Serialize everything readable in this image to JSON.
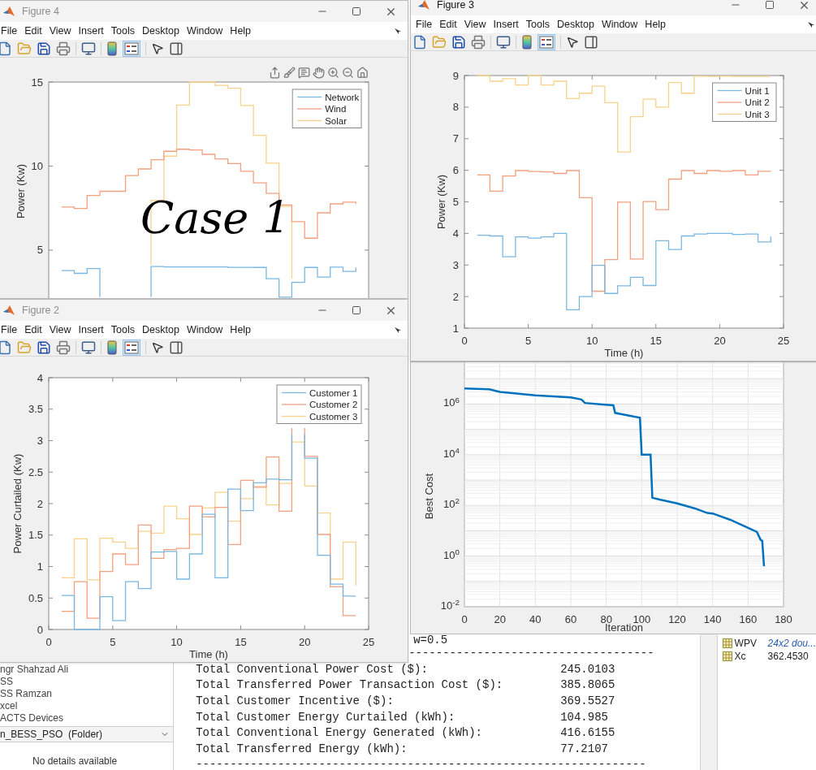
{
  "figures": [
    {
      "title": "Figure 4",
      "active": false,
      "menu": [
        "File",
        "Edit",
        "View",
        "Insert",
        "Tools",
        "Desktop",
        "Window",
        "Help"
      ],
      "legend_on": true,
      "axes_toolbar": true,
      "note": "Case 1",
      "chart_data": {
        "type": "line",
        "ylabel": "Power (Kw)",
        "x": [
          1,
          2,
          2,
          3,
          3,
          4,
          4,
          5,
          5,
          6,
          6,
          7,
          7,
          8,
          8,
          9,
          9,
          10,
          10,
          11,
          11,
          12,
          12,
          13,
          13,
          14,
          14,
          15,
          15,
          16,
          16,
          17,
          17,
          18,
          18,
          19,
          19,
          20,
          20,
          21,
          21,
          22,
          22,
          23,
          23,
          24,
          24
        ],
        "xlim": [
          0,
          25
        ],
        "ylim": [
          2,
          15
        ],
        "yticks": [
          5,
          10,
          15
        ],
        "legend": true,
        "series": [
          {
            "name": "Network",
            "color": "#7ab8e3",
            "values": [
              3.78,
              3.78,
              3.62,
              3.62,
              3.9,
              3.9,
              2.2,
              null,
              null,
              null,
              null,
              null,
              null,
              2.2,
              4.02,
              4.02,
              4.0,
              4.0,
              4.0,
              4.0,
              4.0,
              4.0,
              4.0,
              4.0,
              4.0,
              4.0,
              3.98,
              3.98,
              3.98,
              3.98,
              3.97,
              3.97,
              3.3,
              3.3,
              2.2,
              2.2,
              3.08,
              3.08,
              3.97,
              3.97,
              3.4,
              3.4,
              3.99,
              3.99,
              3.73,
              3.73,
              3.97
            ]
          },
          {
            "name": "Wind",
            "color": "#f2a07f",
            "values": [
              7.56,
              7.56,
              7.48,
              7.48,
              8.25,
              8.25,
              8.5,
              8.5,
              8.5,
              8.5,
              9.44,
              9.44,
              9.83,
              9.83,
              10.38,
              10.38,
              10.88,
              10.88,
              11.0,
              11.0,
              10.96,
              10.96,
              10.7,
              10.7,
              10.43,
              10.43,
              10.15,
              10.15,
              9.69,
              9.69,
              9.0,
              9.0,
              8.37,
              8.37,
              7.68,
              7.68,
              6.69,
              6.69,
              5.71,
              5.71,
              7.22,
              7.22,
              7.75,
              7.75,
              7.85,
              7.85,
              7.75
            ]
          },
          {
            "name": "Solar",
            "color": "#f8d28a",
            "values": [
              null,
              null,
              null,
              null,
              null,
              null,
              null,
              null,
              null,
              null,
              null,
              null,
              null,
              4.1,
              7.96,
              7.96,
              10.59,
              10.59,
              13.63,
              13.63,
              15.0,
              15.0,
              15.0,
              15.0,
              14.8,
              14.8,
              14.63,
              14.63,
              13.6,
              13.6,
              11.83,
              11.83,
              10.17,
              10.17,
              7.6,
              7.6,
              3.3,
              null,
              null,
              null,
              null,
              null,
              null,
              null,
              null,
              null,
              null
            ]
          }
        ]
      }
    },
    {
      "title": "Figure 3",
      "active": true,
      "menu": [
        "File",
        "Edit",
        "View",
        "Insert",
        "Tools",
        "Desktop",
        "Window",
        "Help"
      ],
      "legend_on": true,
      "axes_toolbar": false,
      "chart_data": {
        "type": "line",
        "xlabel": "Time (h)",
        "ylabel": "Power (Kw)",
        "x": [
          1,
          2,
          2,
          3,
          3,
          4,
          4,
          5,
          5,
          6,
          6,
          7,
          7,
          8,
          8,
          9,
          9,
          10,
          10,
          11,
          11,
          12,
          12,
          13,
          13,
          14,
          14,
          15,
          15,
          16,
          16,
          17,
          17,
          18,
          18,
          19,
          19,
          20,
          20,
          21,
          21,
          22,
          22,
          23,
          23,
          24,
          24
        ],
        "xlim": [
          0,
          25
        ],
        "ylim": [
          1,
          9
        ],
        "xticks": [
          0,
          5,
          10,
          15,
          20,
          25
        ],
        "yticks": [
          1,
          2,
          3,
          4,
          5,
          6,
          7,
          8,
          9
        ],
        "legend": true,
        "series": [
          {
            "name": "Unit 1",
            "color": "#7ab8e3",
            "values": [
              3.94,
              3.94,
              3.92,
              3.92,
              3.26,
              3.26,
              3.89,
              3.89,
              3.85,
              3.85,
              3.89,
              3.89,
              4.0,
              4.0,
              1.58,
              1.58,
              2.0,
              2.0,
              2.99,
              2.99,
              2.1,
              2.1,
              2.34,
              2.34,
              2.61,
              2.61,
              2.35,
              2.35,
              3.77,
              3.77,
              3.49,
              3.49,
              3.92,
              3.92,
              3.98,
              3.98,
              4.0,
              4.0,
              4.0,
              4.0,
              3.97,
              3.97,
              3.98,
              3.98,
              3.73,
              3.73,
              3.9
            ]
          },
          {
            "name": "Unit 2",
            "color": "#f2a07f",
            "values": [
              5.85,
              5.85,
              5.34,
              5.34,
              5.82,
              5.82,
              5.99,
              5.99,
              5.96,
              5.96,
              5.95,
              5.95,
              5.9,
              5.9,
              5.99,
              5.99,
              5.13,
              5.13,
              2.17,
              2.17,
              3.17,
              3.17,
              4.99,
              4.99,
              3.19,
              3.19,
              5.01,
              5.01,
              4.75,
              4.75,
              5.72,
              5.72,
              5.99,
              5.99,
              5.9,
              5.9,
              5.99,
              5.99,
              5.97,
              5.97,
              5.99,
              5.99,
              5.85,
              5.85,
              5.97,
              5.97,
              5.96
            ]
          },
          {
            "name": "Unit 3",
            "color": "#f8d28a",
            "values": [
              9.0,
              9.0,
              8.82,
              8.82,
              8.9,
              8.9,
              8.7,
              8.7,
              9.0,
              9.0,
              8.7,
              8.7,
              8.82,
              8.82,
              8.27,
              8.27,
              8.44,
              8.44,
              8.66,
              8.66,
              8.14,
              8.14,
              6.58,
              6.58,
              7.7,
              7.7,
              8.25,
              8.25,
              8.0,
              8.0,
              8.78,
              8.78,
              8.44,
              8.44,
              8.98,
              8.98,
              8.97,
              8.97,
              8.98,
              8.98,
              8.97,
              8.97,
              8.97,
              8.97,
              8.97,
              8.97,
              8.97
            ]
          }
        ]
      }
    }
  ],
  "convergence_plot": {
    "xlabel": "Iteration",
    "ylabel": "Best Cost",
    "xticks": [
      "0",
      "20",
      "40",
      "60",
      "80",
      "100",
      "120",
      "140",
      "160",
      "180"
    ],
    "yticks": [
      "10$^{6}$",
      "10$^{4}$",
      "10$^{2}$",
      "10$^{0}$",
      "10$^{-2}$"
    ]
  },
  "figure_front": {
    "title": "Figure 2",
    "active": false,
    "menu": [
      "File",
      "Edit",
      "View",
      "Insert",
      "Tools",
      "Desktop",
      "Window",
      "Help"
    ],
    "legend_on": true,
    "axes_toolbar": false,
    "chart_data": {
      "type": "line",
      "xlabel": "Time (h)",
      "ylabel": "Power Curtailed (Kw)",
      "x": [
        1,
        2,
        2,
        3,
        3,
        4,
        4,
        5,
        5,
        6,
        6,
        7,
        7,
        8,
        8,
        9,
        9,
        10,
        10,
        11,
        11,
        12,
        12,
        13,
        13,
        14,
        14,
        15,
        15,
        16,
        16,
        17,
        17,
        18,
        18,
        19,
        19,
        19.5,
        20,
        20,
        21,
        21,
        22,
        22,
        23,
        23,
        24,
        24
      ],
      "xlim": [
        0,
        25
      ],
      "ylim": [
        0,
        4
      ],
      "xticks": [
        0,
        5,
        10,
        15,
        20,
        25
      ],
      "yticks": [
        0,
        0.5,
        1,
        1.5,
        2,
        2.5,
        3,
        3.5,
        4
      ],
      "legend": true,
      "series": [
        {
          "name": "Customer 1",
          "color": "#7ab8e3",
          "values": [
            0.54,
            0.54,
            0,
            0,
            0,
            0,
            0.52,
            0.52,
            0.14,
            0.14,
            0.76,
            0.76,
            0.65,
            0.65,
            1.23,
            1.23,
            1.24,
            1.24,
            0.8,
            0.8,
            1.2,
            1.2,
            1.83,
            1.83,
            0.82,
            0.82,
            2.23,
            2.23,
            1.89,
            1.89,
            2.33,
            2.33,
            2.39,
            2.39,
            2.38,
            2.38,
            3.1,
            null,
            3.1,
            2.72,
            2.72,
            1.18,
            1.18,
            0.72,
            0.72,
            0.53,
            0.53,
            0.53
          ]
        },
        {
          "name": "Customer 2",
          "color": "#f2a07f",
          "values": [
            0.29,
            0.29,
            0.76,
            0.76,
            0.18,
            0.18,
            0.92,
            0.92,
            1.2,
            1.2,
            1.03,
            1.03,
            1.66,
            1.66,
            1.13,
            1.13,
            1.27,
            1.27,
            1.29,
            1.29,
            1.96,
            1.96,
            1.79,
            1.79,
            1.94,
            1.94,
            1.35,
            1.35,
            2.37,
            2.37,
            2.26,
            2.26,
            2.74,
            2.74,
            1.88,
            1.88,
            3.2,
            null,
            3.2,
            2.75,
            2.75,
            1.51,
            1.51,
            0.68,
            0.68,
            0.22,
            0.22,
            0.22
          ]
        },
        {
          "name": "Customer 3",
          "color": "#f8d28a",
          "values": [
            0.82,
            0.82,
            1.44,
            1.44,
            0.79,
            0.79,
            1.45,
            1.45,
            1.39,
            1.39,
            1.29,
            1.29,
            1.56,
            1.56,
            1.53,
            1.53,
            1.96,
            1.96,
            1.76,
            1.76,
            1.51,
            1.51,
            1.93,
            1.93,
            2.18,
            2.18,
            1.72,
            1.72,
            2.08,
            2.08,
            2.27,
            2.27,
            1.98,
            1.98,
            2.32,
            2.32,
            2.98,
            2.98,
            2.98,
            2.28,
            2.28,
            1.85,
            1.85,
            0.8,
            0.8,
            1.39,
            1.39,
            0.7
          ]
        }
      ]
    }
  },
  "desktop": {
    "folder_panel": {
      "items": [
        "ngr Shahzad Ali",
        "SS",
        "SS Ramzan",
        "xcel",
        "ACTS Devices"
      ],
      "folder": "n_BESS_PSO  (Folder)",
      "details": "No details available"
    },
    "command_window": {
      "first_line": "w=0.5",
      "rule": "------------------------------------",
      "output": [
        {
          "label": "Total Conventional Power Cost ($):",
          "value": "245.0103"
        },
        {
          "label": "Total Transferred Power Transaction Cost ($):",
          "value": "385.8065"
        },
        {
          "label": "Total Customer Incentive ($):",
          "value": "369.5527"
        },
        {
          "label": "Total Customer Energy Curtailed (kWh):",
          "value": "104.985"
        },
        {
          "label": "Total Conventional Energy Generated (kWh):",
          "value": "416.6155"
        },
        {
          "label": "Total Transferred Energy (kWh):",
          "value": "77.2107"
        }
      ],
      "closing_rule": "------------------------------------------------------------------"
    },
    "workspace": {
      "rows": [
        {
          "name": "WPV",
          "value": "24x2 dou...",
          "kind": "summary"
        },
        {
          "name": "Xc",
          "value": "362.4530",
          "kind": "number"
        }
      ]
    }
  }
}
